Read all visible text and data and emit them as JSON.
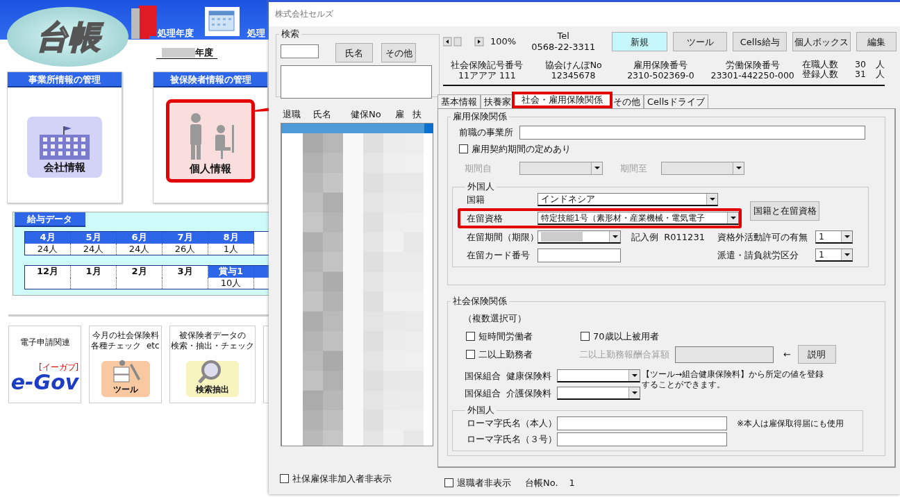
{
  "app": {
    "logo": "台帳",
    "year_label": "処理年度",
    "cut_label": "処理",
    "year_value": "年度"
  },
  "panels": [
    {
      "title": "事業所情報の管理",
      "button": "会社情報",
      "kind": "company",
      "highlighted": false
    },
    {
      "title": "被保険者情報の管理",
      "button": "個人情報",
      "kind": "person",
      "highlighted": true
    }
  ],
  "salary": {
    "title": "給与データ",
    "rows": [
      {
        "cells": [
          {
            "header": "4月",
            "value": "24人",
            "highlighted": true
          },
          {
            "header": "5月",
            "value": "24人",
            "highlighted": true
          },
          {
            "header": "6月",
            "value": "24人",
            "highlighted": true
          },
          {
            "header": "7月",
            "value": "26人",
            "highlighted": true
          },
          {
            "header": "8月",
            "value": "1人",
            "highlighted": true
          },
          {
            "highlighted": false
          }
        ]
      },
      {
        "cells": [
          {
            "header": "12月",
            "highlighted": false
          },
          {
            "header": "1月",
            "highlighted": false
          },
          {
            "header": "2月",
            "highlighted": false
          },
          {
            "header": "3月",
            "highlighted": false
          },
          {
            "header": "賞与1",
            "value": "10人",
            "highlighted": true
          },
          {
            "highlighted": true
          }
        ]
      }
    ]
  },
  "tiles": [
    {
      "caption": "電子申請関連",
      "kind": "egov",
      "logo": "e-Gov",
      "logo_sub": "[イーガブ]"
    },
    {
      "caption_lines": [
        "今月の社会保険料",
        "各種チェック  etc"
      ],
      "kind": "tool",
      "button": "ツール"
    },
    {
      "caption_lines": [
        "被保険者データの",
        "検索・抽出・チェック"
      ],
      "kind": "search",
      "button": "検索抽出"
    },
    {
      "kind": "cut"
    }
  ],
  "dialog": {
    "title": "株式会社セルズ",
    "search": {
      "legend": "検索",
      "buttons": [
        "氏名",
        "その他"
      ]
    },
    "list": {
      "columns": [
        "退職",
        "氏名",
        "健保No",
        "雇",
        "扶"
      ]
    },
    "list_filter": {
      "label": "社保雇保非加入者非表示",
      "checked": false
    },
    "zoom": "100%",
    "tel": {
      "label": "Tel",
      "value": "0568-22-3311"
    },
    "toolbar": [
      {
        "label": "新規",
        "selected": true
      },
      {
        "label": "ツール",
        "selected": false
      },
      {
        "label": "Cells給与",
        "selected": false
      },
      {
        "label": "個人ボックス",
        "selected": false
      },
      {
        "label": "編集",
        "selected": false
      }
    ],
    "info": [
      {
        "label": "社会保険記号番号",
        "value": "11アアア 111"
      },
      {
        "label": "協会けんぽNo",
        "value": "12345678"
      },
      {
        "label": "雇用保険番号",
        "value": "2310-502369-0"
      },
      {
        "label": "労働保険番号",
        "value": "23301-442250-000"
      }
    ],
    "counts": [
      {
        "label": "在職人数",
        "value": "30",
        "unit": "人"
      },
      {
        "label": "登録人数",
        "value": "31",
        "unit": "人"
      }
    ],
    "tabs": [
      {
        "label": "基本情報",
        "selected": false
      },
      {
        "label": "扶養家",
        "selected": false
      },
      {
        "label": "社会・雇用保険関係",
        "selected": true
      },
      {
        "label": "その他",
        "selected": false
      },
      {
        "label": "Cellsドライブ",
        "selected": false
      }
    ],
    "employment": {
      "legend": "雇用保険関係",
      "previous_office": {
        "label": "前職の事業所"
      },
      "fixed_term": {
        "label": "雇用契約期間の定めあり",
        "checked": false
      },
      "period_from": {
        "label": "期間自",
        "disabled": true
      },
      "period_to": {
        "label": "期間至",
        "disabled": true
      },
      "foreign": {
        "legend": "外国人",
        "nationality": {
          "label": "国籍",
          "value": "インドネシア"
        },
        "nationality_button": "国籍と在留資格",
        "status": {
          "label": "在留資格",
          "value": "特定技能1号（素形材・産業機械・電気電子",
          "highlighted": true
        },
        "period": {
          "label": "在留期間（期限）"
        },
        "example": "記入例  R011231",
        "work_permit": {
          "label": "資格外活動許可の有無",
          "value": "1"
        },
        "card_no": {
          "label": "在留カード番号"
        },
        "dispatch": {
          "label": "派遣・請負就労区分",
          "value": "1"
        }
      }
    },
    "social": {
      "legend": "社会保険関係",
      "note": "（複数選択可）",
      "checks": [
        {
          "label": "短時間労働者",
          "checked": false
        },
        {
          "label": "70歳以上被用者",
          "checked": false
        },
        {
          "label": "二以上勤務者",
          "checked": false
        }
      ],
      "combined_pay": {
        "label": "二以上勤務報酬合算額",
        "disabled": true
      },
      "arrow": "←",
      "explain_button": "説明",
      "premiums": [
        {
          "label": "国保組合  健康保険料"
        },
        {
          "label": "国保組合  介護保険料"
        }
      ],
      "premium_note": "【ツール→組合健康保険料】から所定の値を登録することができます。",
      "foreign": {
        "legend": "外国人",
        "names": [
          {
            "label": "ローマ字氏名（本人）"
          },
          {
            "label": "ローマ字氏名（３号）"
          }
        ],
        "note": "※本人は雇保取得届にも使用"
      }
    },
    "footer": {
      "retired_filter": {
        "label": "退職者非表示",
        "checked": false
      },
      "ledger_label": "台帳No.",
      "ledger_no": "1"
    }
  }
}
